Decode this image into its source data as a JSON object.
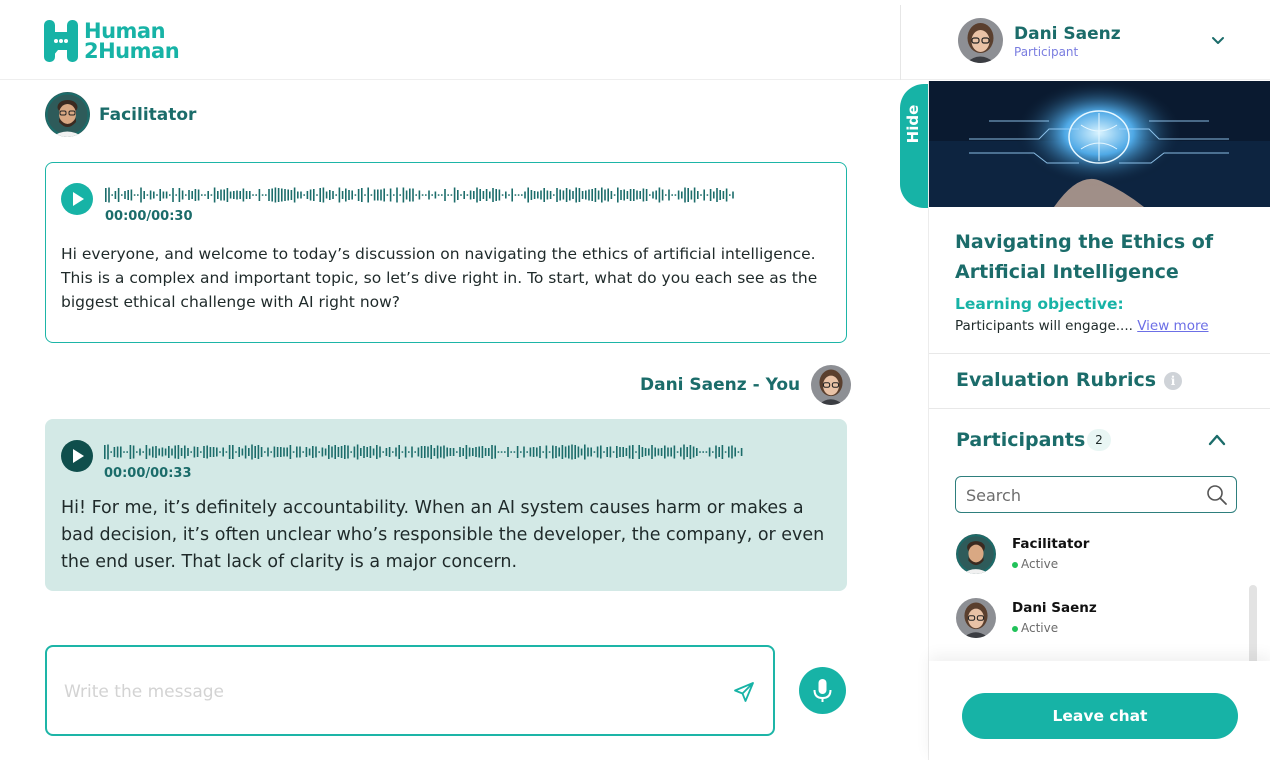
{
  "brand": {
    "logo_line1": "Human",
    "logo_line2": "2Human",
    "accent": "#17b3a6",
    "dark_accent": "#1b6c6a"
  },
  "user": {
    "name": "Dani Saenz",
    "role": "Participant"
  },
  "chat": {
    "messages": [
      {
        "sender": "Facilitator",
        "audio_time": "00:00/00:30",
        "text": "Hi everyone, and welcome to today’s discussion on navigating the ethics of artificial intelligence. This is a complex and important topic, so let’s dive right in. To start, what do you each see as the biggest ethical challenge with AI right now?"
      },
      {
        "sender": "Dani Saenz - You",
        "audio_time": "00:00/00:33",
        "text": "Hi! For me, it’s definitely accountability. When an AI system causes harm or makes a bad decision, it’s often unclear who’s responsible the developer, the company, or even the end user. That lack of clarity is a major concern."
      }
    ],
    "composer_placeholder": "Write the message"
  },
  "sidebar": {
    "hide_label": "Hide",
    "course_title": "Navigating the Ethics of Artificial Intelligence",
    "objective_label": "Learning objective:",
    "objective_text": "Participants will engage....",
    "view_more": "View more",
    "rubrics_label": "Evaluation Rubrics",
    "participants_label": "Participants",
    "participants_count": "2",
    "search_placeholder": "Search",
    "participants": [
      {
        "name": "Facilitator",
        "status": "Active"
      },
      {
        "name": "Dani Saenz",
        "status": "Active"
      }
    ],
    "leave_label": "Leave chat"
  }
}
